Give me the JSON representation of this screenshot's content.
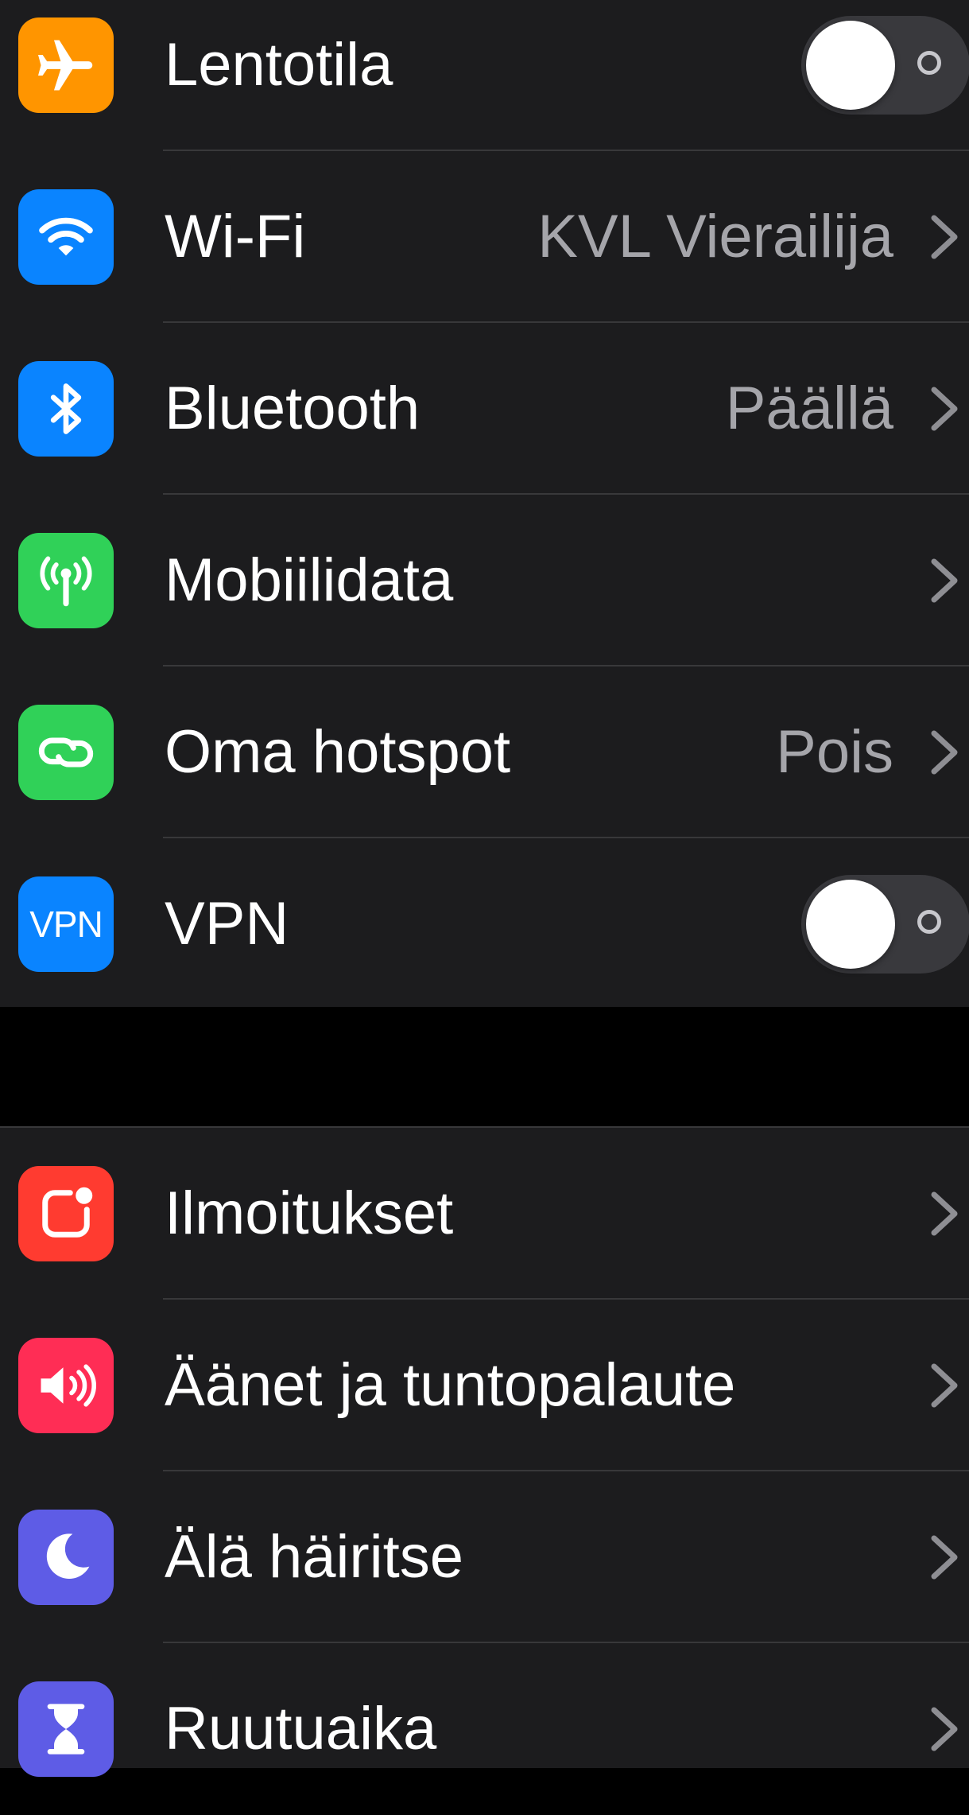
{
  "groups": [
    {
      "rows": [
        {
          "label": "Lentotila",
          "icon": "airplane-icon",
          "icon_color": "#ff9500",
          "accessory": "toggle",
          "toggle_on": false
        },
        {
          "label": "Wi-Fi",
          "icon": "wifi-icon",
          "icon_color": "#0a84ff",
          "value": "KVL Vierailija",
          "accessory": "chevron"
        },
        {
          "label": "Bluetooth",
          "icon": "bluetooth-icon",
          "icon_color": "#0a84ff",
          "value": "Päällä",
          "accessory": "chevron"
        },
        {
          "label": "Mobiilidata",
          "icon": "antenna-icon",
          "icon_color": "#30d158",
          "accessory": "chevron"
        },
        {
          "label": "Oma hotspot",
          "icon": "hotspot-icon",
          "icon_color": "#30d158",
          "value": "Pois",
          "accessory": "chevron"
        },
        {
          "label": "VPN",
          "icon": "vpn-icon",
          "icon_text": "VPN",
          "icon_color": "#0a84ff",
          "accessory": "toggle",
          "toggle_on": false
        }
      ]
    },
    {
      "rows": [
        {
          "label": "Ilmoitukset",
          "icon": "notifications-icon",
          "icon_color": "#ff3b30",
          "accessory": "chevron"
        },
        {
          "label": "Äänet ja tuntopalaute",
          "icon": "speaker-icon",
          "icon_color": "#ff2d55",
          "accessory": "chevron"
        },
        {
          "label": "Älä häiritse",
          "icon": "moon-icon",
          "icon_color": "#5e5ce6",
          "accessory": "chevron"
        },
        {
          "label": "Ruutuaika",
          "icon": "hourglass-icon",
          "icon_color": "#5e5ce6",
          "accessory": "chevron"
        }
      ]
    }
  ]
}
